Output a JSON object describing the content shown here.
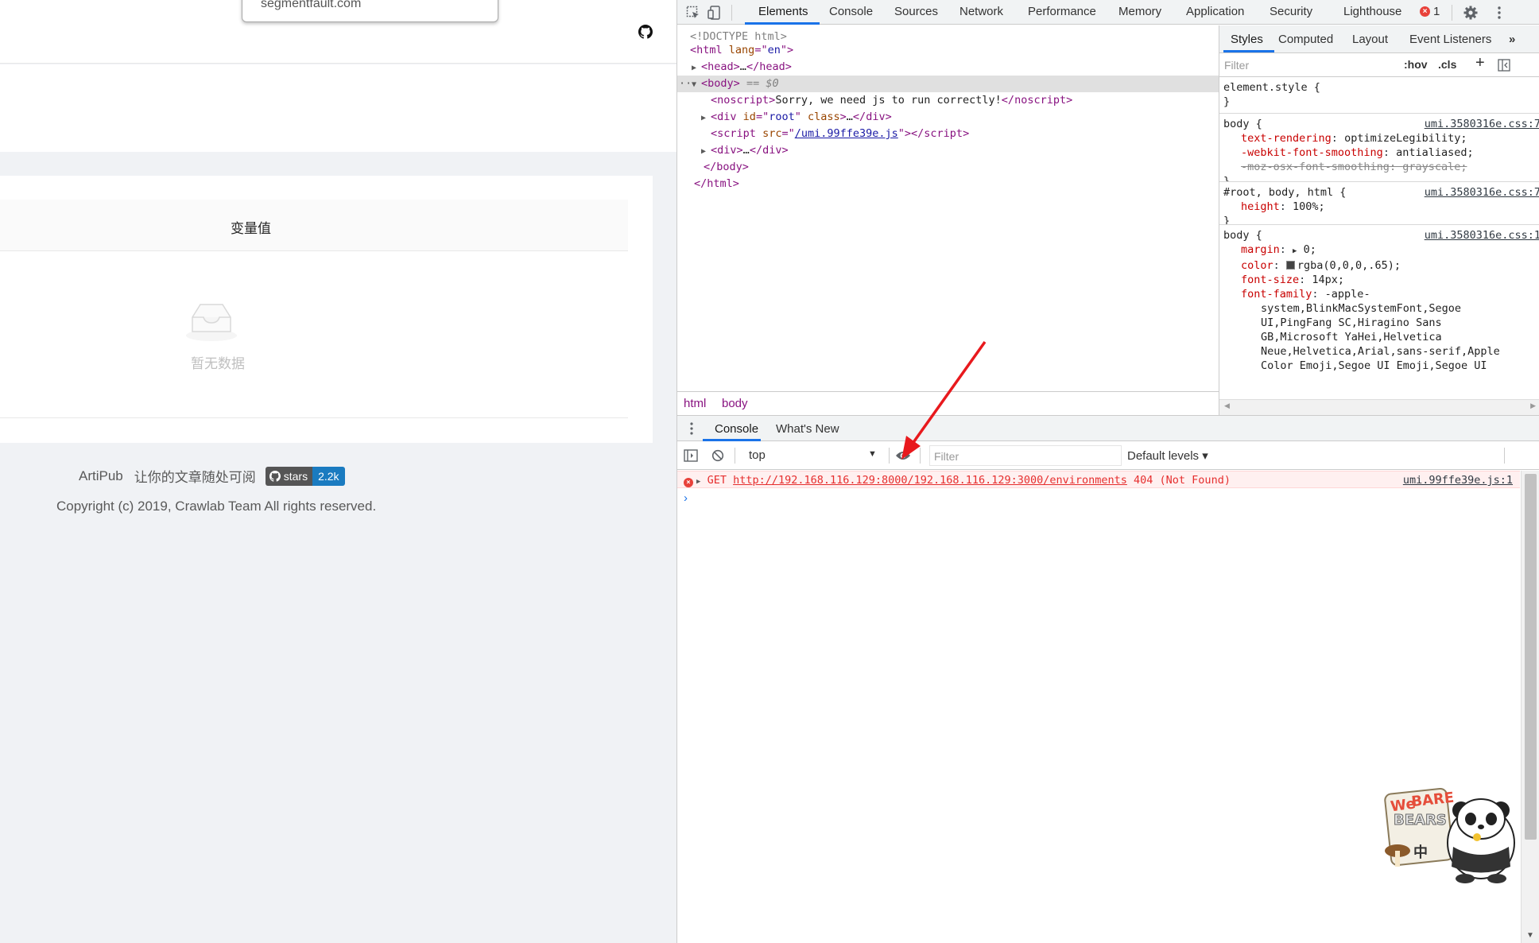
{
  "page": {
    "url_popup": "segmentfault.com",
    "table_header": "变量值",
    "empty_text": "暂无数据",
    "footer": {
      "brand": "ArtiPub",
      "slogan": "让你的文章随处可阅",
      "badge_label": "stars",
      "badge_value": "2.2k",
      "copyright": "Copyright (c) 2019, Crawlab Team All rights reserved."
    }
  },
  "devtools": {
    "tabs": [
      "Elements",
      "Console",
      "Sources",
      "Network",
      "Performance",
      "Memory",
      "Application",
      "Security",
      "Lighthouse"
    ],
    "active_tab": "Elements",
    "error_count": "1",
    "dom": {
      "doctype": "<!DOCTYPE html>",
      "html_open_tag": "html",
      "html_attr": "lang",
      "html_attr_val": "en",
      "head_tag": "head",
      "head_ellipsis": "…",
      "body_tag": "body",
      "body_eq": "== $0",
      "noscript_tag": "noscript",
      "noscript_text": "Sorry, we need js to run correctly!",
      "div_tag": "div",
      "div_attr1": "id",
      "div_attr1_val": "root",
      "div_attr2": "class",
      "script_tag": "script",
      "script_attr": "src",
      "script_src": "/umi.99ffe39e.js",
      "ellipsis": "…"
    },
    "breadcrumbs": [
      "html",
      "body"
    ],
    "styles": {
      "tabs": [
        "Styles",
        "Computed",
        "Layout",
        "Event Listeners"
      ],
      "filter_placeholder": "Filter",
      "hov": ":hov",
      "cls": ".cls",
      "rules": [
        {
          "selector": "element.style {",
          "source": "",
          "props": []
        },
        {
          "selector": "body {",
          "source": "umi.3580316e.css:7",
          "props": [
            {
              "name": "text-rendering",
              "value": "optimizeLegibility;"
            },
            {
              "name": "-webkit-font-smoothing",
              "value": "antialiased;"
            },
            {
              "name": "-moz-osx-font-smoothing",
              "value": "grayscale;"
            }
          ]
        },
        {
          "selector": "#root, body, html {",
          "source": "umi.3580316e.css:7",
          "props": [
            {
              "name": "height",
              "value": "100%;"
            }
          ]
        },
        {
          "selector": "body {",
          "source": "umi.3580316e.css:1",
          "props": [
            {
              "name": "margin",
              "value": "0;"
            },
            {
              "name": "color",
              "value": "rgba(0,0,0,.65);"
            },
            {
              "name": "font-size",
              "value": "14px;"
            },
            {
              "name": "font-family",
              "value": "-apple-"
            }
          ]
        }
      ],
      "font_family_cont": [
        "system,BlinkMacSystemFont,Segoe",
        "UI,PingFang SC,Hiragino Sans",
        "GB,Microsoft YaHei,Helvetica",
        "Neue,Helvetica,Arial,sans-serif,Apple",
        "Color Emoji,Segoe UI Emoji,Segoe UI"
      ],
      "closing_brace": "}"
    },
    "drawer": {
      "tabs": [
        "Console",
        "What's New"
      ],
      "context": "top",
      "filter_placeholder": "Filter",
      "levels": "Default levels ▾",
      "error": {
        "method": "GET",
        "url": "http://192.168.116.129:8000/192.168.116.129:3000/environments",
        "status": "404 (Not Found)",
        "source": "umi.99ffe39e.js:1"
      },
      "prompt": "›"
    }
  }
}
